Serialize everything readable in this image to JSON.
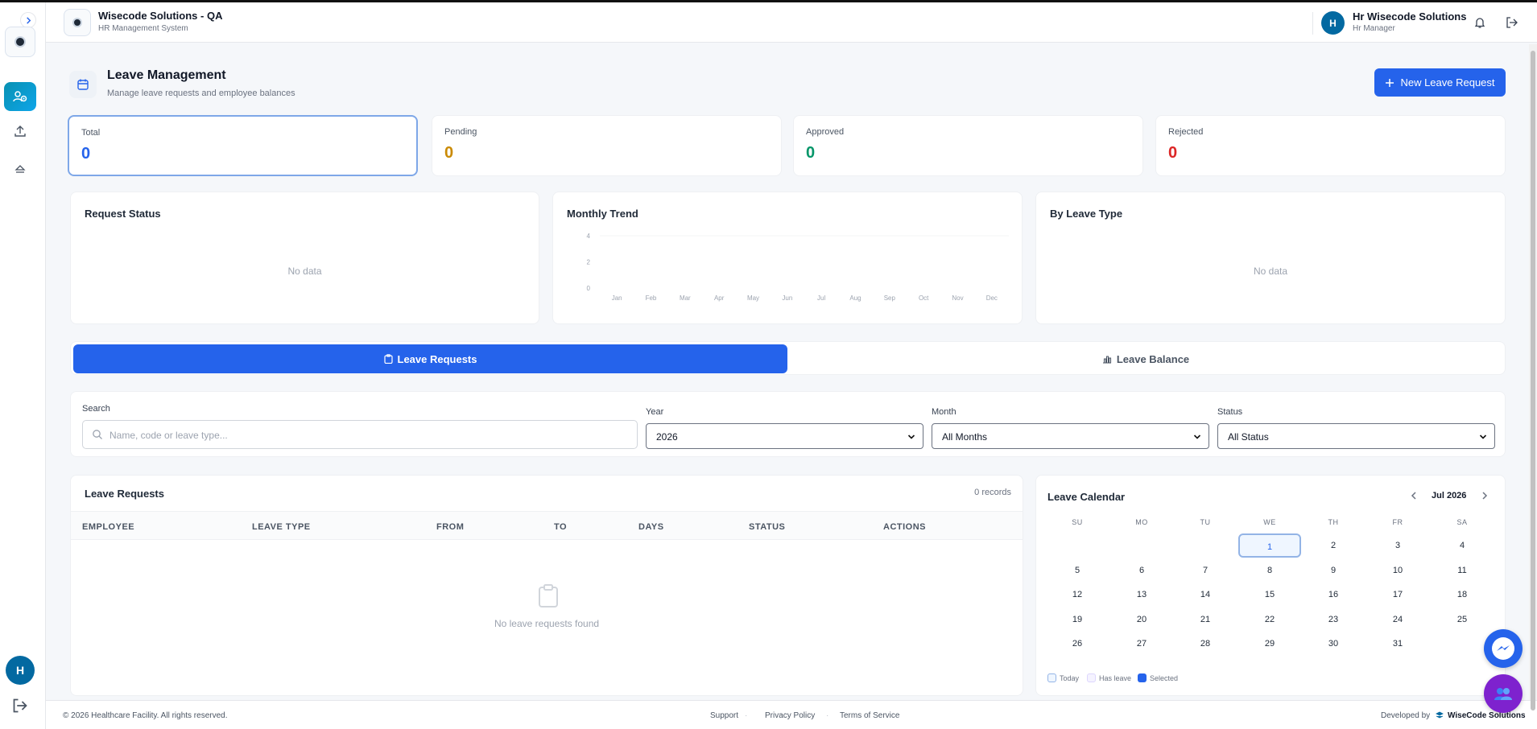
{
  "header": {
    "org_title": "Wisecode Solutions - QA",
    "org_subtitle": "HR Management System",
    "user_initial": "H",
    "user_name": "Hr Wisecode Solutions",
    "user_role": "Hr Manager"
  },
  "sidebar": {
    "avatar_initial": "H",
    "items": [
      {
        "name": "dashboard",
        "icon": "people-gear-icon",
        "active": true
      },
      {
        "name": "upload",
        "icon": "upload-icon",
        "active": false
      },
      {
        "name": "eject",
        "icon": "eject-icon",
        "active": false
      }
    ]
  },
  "page": {
    "title": "Leave Management",
    "subtitle": "Manage leave requests and employee balances",
    "new_button": "New Leave Request"
  },
  "stats": [
    {
      "label": "Total",
      "value": "0",
      "color": "#2563eb"
    },
    {
      "label": "Pending",
      "value": "0",
      "color": "#ca8a04"
    },
    {
      "label": "Approved",
      "value": "0",
      "color": "#059669"
    },
    {
      "label": "Rejected",
      "value": "0",
      "color": "#dc2626"
    }
  ],
  "charts": {
    "request_status": {
      "title": "Request Status",
      "empty": "No data"
    },
    "monthly_trend": {
      "title": "Monthly Trend"
    },
    "by_leave_type": {
      "title": "By Leave Type",
      "empty": "No data"
    }
  },
  "chart_data": {
    "type": "line",
    "title": "Monthly Trend",
    "categories": [
      "Jan",
      "Feb",
      "Mar",
      "Apr",
      "May",
      "Jun",
      "Jul",
      "Aug",
      "Sep",
      "Oct",
      "Nov",
      "Dec"
    ],
    "series": [
      {
        "values": [
          0,
          0,
          0,
          0,
          0,
          0,
          0,
          0,
          0,
          0,
          0,
          0
        ]
      }
    ],
    "yticks": [
      "4",
      "2",
      "0"
    ],
    "ylim": [
      0,
      4
    ],
    "grid": false
  },
  "tabs": [
    {
      "label": "Leave Requests",
      "active": true
    },
    {
      "label": "Leave Balance",
      "active": false
    }
  ],
  "filters": {
    "search_label": "Search",
    "search_placeholder": "Name, code or leave type...",
    "year_label": "Year",
    "year_value": "2026",
    "month_label": "Month",
    "month_value": "All Months",
    "status_label": "Status",
    "status_value": "All Status"
  },
  "table": {
    "title": "Leave Requests",
    "count": "0 records",
    "columns": [
      "EMPLOYEE",
      "LEAVE TYPE",
      "FROM",
      "TO",
      "DAYS",
      "STATUS",
      "ACTIONS"
    ],
    "empty": "No leave requests found"
  },
  "calendar": {
    "title": "Leave Calendar",
    "month": "Jul 2026",
    "weekdays": [
      "SU",
      "MO",
      "TU",
      "WE",
      "TH",
      "FR",
      "SA"
    ],
    "first_weekday": 3,
    "days_in_month": 31,
    "today": 1,
    "legend": [
      "Today",
      "Has leave",
      "Selected"
    ]
  },
  "footer": {
    "copyright": "© 2026 Healthcare Facility. All rights reserved.",
    "links": [
      "Support",
      "Privacy Policy",
      "Terms of Service"
    ],
    "developed_by": "Developed by",
    "brand": "WiseCode Solutions"
  }
}
